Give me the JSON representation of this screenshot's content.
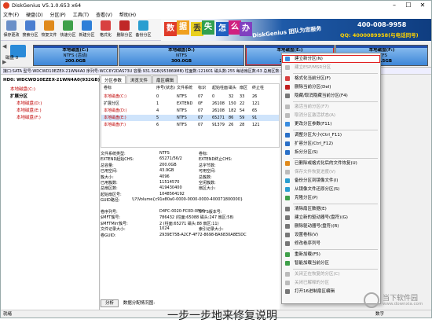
{
  "window": {
    "title": "DiskGenius V5.1.0.653 x64",
    "min": "–",
    "max": "☐",
    "close": "✕"
  },
  "menu": [
    "文件(F)",
    "硬盘(D)",
    "分区(P)",
    "工具(T)",
    "查看(V)",
    "帮助(H)"
  ],
  "toolbar": [
    {
      "label": "保存更改",
      "color": "#6a8fc8"
    },
    {
      "label": "搜索分区",
      "color": "#4a7ed0"
    },
    {
      "label": "恢复文件",
      "color": "#e08a1c"
    },
    {
      "label": "快速分区",
      "color": "#3fa04a"
    },
    {
      "label": "新建分区",
      "color": "#2f7fd8"
    },
    {
      "label": "格式化",
      "color": "#d84040"
    },
    {
      "label": "删除分区",
      "color": "#c02828"
    },
    {
      "label": "备份分区",
      "color": "#2a9ed0"
    }
  ],
  "banner": {
    "chars": [
      "数",
      "据",
      "丢",
      "失",
      "怎",
      "么",
      "办"
    ],
    "brand": "DiskGenius 团队为您服务",
    "phone": "400-008-9958",
    "qq": "QQ: 4000089958(与电话同号)"
  },
  "disk": {
    "label": "磁盘 0",
    "nav_up": "◀",
    "nav_down": "▶"
  },
  "partitions": [
    {
      "name": "本地磁盘(C:)",
      "fs": "NTFS (活动)",
      "size": "200.0GB"
    },
    {
      "name": "本地磁盘(D:)",
      "fs": "NTFS",
      "size": "300.0GB"
    },
    {
      "name": "本地磁盘(E:)",
      "fs": "NTFS",
      "size": "200.0GB"
    },
    {
      "name": "本地磁盘(F:)",
      "fs": "NTFS",
      "size": "231.5GB"
    }
  ],
  "infobar": "接口:SATA  型号:WDCWD10EZEX-21WN4A0  序列号:WCC6Y2DAS73U  容量:931.5GB(953869MB)  柱面数:121601  磁头数:255  每道扇区数:63  总扇区数:1953525168",
  "tree": {
    "root": "HD0: WDCWD10EZEX-21WN4A0(932GB)",
    "items": [
      {
        "label": "本地磁盘(C:)",
        "red": true
      },
      {
        "label": "扩展分区",
        "red": false
      },
      {
        "label": "本地磁盘(D:)",
        "red": true
      },
      {
        "label": "本地磁盘(E:)",
        "red": true
      },
      {
        "label": "本地磁盘(F:)",
        "red": true
      }
    ]
  },
  "tabs": [
    "分区参数",
    "浏览文件",
    "扇区编辑"
  ],
  "ptable": {
    "headers": [
      "卷标",
      "序号(状态)",
      "文件系统",
      "标识",
      "起始柱面",
      "磁头",
      "扇区",
      "终止柱"
    ],
    "rows": [
      [
        "本地磁盘(C:)",
        "0",
        "NTFS",
        "07",
        "0",
        "32",
        "33",
        "26"
      ],
      [
        "扩展分区",
        "1",
        "EXTEND",
        "0F",
        "26108",
        "150",
        "22",
        "121"
      ],
      [
        "本地磁盘(D:)",
        "4",
        "NTFS",
        "07",
        "26108",
        "182",
        "54",
        "65"
      ],
      [
        "本地磁盘(E:)",
        "5",
        "NTFS",
        "07",
        "65271",
        "86",
        "59",
        "91"
      ],
      [
        "本地磁盘(F:)",
        "6",
        "NTFS",
        "07",
        "91379",
        "26",
        "28",
        "121"
      ]
    ]
  },
  "details": [
    [
      "文件系统类型:",
      "NTFS",
      "卷标:",
      ""
    ],
    [
      "EXTEND起始CHS:",
      "65271/56/2",
      "EXTEND终止CHS:",
      ""
    ],
    [
      "总容量:",
      "200.0GB",
      "总字节数:",
      ""
    ],
    [
      "已用空间:",
      "43.9GB",
      "可用空间:",
      ""
    ],
    [
      "簇大小:",
      "4096",
      "总簇数:",
      ""
    ],
    [
      "已用簇数:",
      "11514570",
      "空闲簇数:",
      ""
    ],
    [
      "总扇区数:",
      "419430400",
      "扇区大小:",
      ""
    ],
    [
      "起始扇区号:",
      "1048564192",
      "",
      ""
    ],
    [
      "GUID路径:",
      "\\\\?\\Volume{c91e80a0-0000-0000-0000-400071800000}",
      "",
      ""
    ],
    [
      "",
      "",
      "",
      ""
    ],
    [
      "卷序列号:",
      "D4FC-0020-FC0D-0F5C",
      "NTFS版本号:",
      ""
    ],
    [
      "$MFT簇号:",
      "786432 (柱面:65088 磁头:247 扇区:58)",
      "",
      ""
    ],
    [
      "$MFTMirr簇号:",
      "2 (柱面:65271 磁头:88 扇区:11)",
      "",
      ""
    ],
    [
      "文件记录大小:",
      "1024",
      "索引记录大小:",
      ""
    ],
    [
      "卷GUID:",
      "2939E75B-A2CF-4F72-8698-BA6830A8E5DC",
      "",
      ""
    ]
  ],
  "buttons": [
    "分析",
    "数据分配情况图:"
  ],
  "context_menu": [
    {
      "label": "建立新分区(N)",
      "disabled": false,
      "highlight": true,
      "color": "#3a8de0"
    },
    {
      "label": "建立ESP/MSR分区",
      "disabled": true,
      "color": "#bbb"
    },
    {
      "label": "格式化当前分区(F)",
      "disabled": false,
      "color": "#d84040"
    },
    {
      "label": "删除当前分区(Del)",
      "disabled": false,
      "color": "#c02020"
    },
    {
      "label": "隐藏/取消隐藏当前分区(F4)",
      "disabled": false,
      "color": "#777"
    },
    {
      "label": "激活当前分区(F7)",
      "disabled": true,
      "color": "#bbb"
    },
    {
      "label": "取消分区激活状态(A)",
      "disabled": true,
      "color": "#bbb"
    },
    {
      "label": "更改分区参数(F11)",
      "disabled": false,
      "color": "#3a8de0"
    },
    {
      "label": "调整分区大小(Ctrl_F11)",
      "disabled": false,
      "color": "#2a70c8"
    },
    {
      "label": "扩容分区(Ctrl_F12)",
      "disabled": false,
      "color": "#2a70c8"
    },
    {
      "label": "拆分分区(S)",
      "disabled": false,
      "color": "#2a70c8"
    },
    {
      "label": "已删除或格式化后的文件恢复(U)",
      "disabled": false,
      "color": "#e08a1c"
    },
    {
      "label": "保存文件恢复进度(V)",
      "disabled": true,
      "color": "#bbb"
    },
    {
      "label": "备份分区到镜像文件(I)",
      "disabled": false,
      "color": "#2a9ed0"
    },
    {
      "label": "从镜像文件还原分区(S)",
      "disabled": false,
      "color": "#2a9ed0"
    },
    {
      "label": "克隆分区(P)",
      "disabled": false,
      "color": "#3fa04a"
    },
    {
      "label": "清除扇区数据(E)",
      "disabled": false,
      "color": "#777"
    },
    {
      "label": "建立新的驱动器号(盘符)(G)",
      "disabled": false,
      "color": "#777"
    },
    {
      "label": "删除驱动器号(盘符)(R)",
      "disabled": false,
      "color": "#777"
    },
    {
      "label": "设置卷标(V)",
      "disabled": false,
      "color": "#777"
    },
    {
      "label": "修改卷序列号",
      "disabled": false,
      "color": "#777"
    },
    {
      "label": "重新加载(F5)",
      "disabled": false,
      "color": "#3fa04a"
    },
    {
      "label": "智能加载当前分区",
      "disabled": false,
      "color": "#3fa04a"
    },
    {
      "label": "关闭正在恢复的分区(C)",
      "disabled": true,
      "color": "#bbb"
    },
    {
      "label": "关闭已解释的分区",
      "disabled": true,
      "color": "#bbb"
    },
    {
      "label": "打开16进制扇区编辑",
      "disabled": false,
      "color": "#777"
    }
  ],
  "status": {
    "left": "就绪",
    "right": "数字"
  },
  "watermark": {
    "t1": "当下软件园",
    "t2": "www.downxia.com"
  },
  "overlay": "一步一步地来修复说明"
}
